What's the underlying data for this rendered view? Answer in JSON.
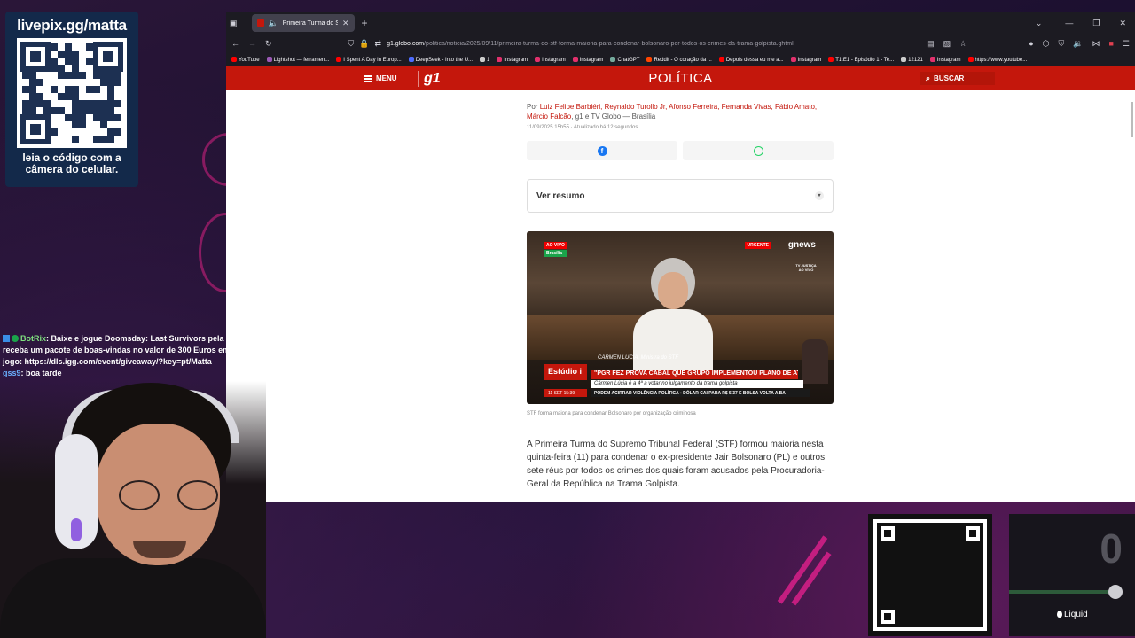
{
  "livepix": {
    "title": "livepix.gg/matta",
    "subtitle_line1": "leia o código com a",
    "subtitle_line2": "câmera do celular."
  },
  "chat": {
    "messages": [
      {
        "user": "BotRix",
        "text": ": Baixe e jogue Doomsday: Last Survivors pela primeira vez e receba um pacote de boas-vindas no valor de 300 Euros em itens no jogo: https://dls.igg.com/event/giveaway/?key=pt/Matta"
      },
      {
        "user": "gss9",
        "text": ": boa tarde"
      }
    ]
  },
  "browser": {
    "tab_title": "Primeira Turma do STF form",
    "url_domain": "g1.globo.com",
    "url_path": "/politica/noticia/2025/09/11/primeira-turma-do-stf-forma-maioria-para-condenar-bolsonaro-por-todos-os-crimes-da-trama-golpista.ghtml",
    "bookmarks": [
      {
        "label": "YouTube",
        "color": "#ff0000"
      },
      {
        "label": "Lightshot — ferramen...",
        "color": "#9b59b6"
      },
      {
        "label": "I Spent A Day in Europ...",
        "color": "#ff0000"
      },
      {
        "label": "DeepSeek - Into the U...",
        "color": "#4d6bfe"
      },
      {
        "label": "1",
        "color": "#cccccc"
      },
      {
        "label": "Instagram",
        "color": "#e1306c"
      },
      {
        "label": "Instagram",
        "color": "#e1306c"
      },
      {
        "label": "Instagram",
        "color": "#e1306c"
      },
      {
        "label": "ChatGPT",
        "color": "#74aa9c"
      },
      {
        "label": "Reddit - O coração da ...",
        "color": "#ff4500"
      },
      {
        "label": "Depois dessa eu me a...",
        "color": "#ff0000"
      },
      {
        "label": "Instagram",
        "color": "#e1306c"
      },
      {
        "label": "T1:E1 - Episódio 1 - Te...",
        "color": "#ff0000"
      },
      {
        "label": "12121",
        "color": "#cccccc"
      },
      {
        "label": "Instagram",
        "color": "#e1306c"
      },
      {
        "label": "https://www.youtube...",
        "color": "#ff0000"
      }
    ]
  },
  "g1": {
    "menu_label": "MENU",
    "logo": "g1",
    "section": "POLÍTICA",
    "search_label": "BUSCAR",
    "brand_color": "#c4170c"
  },
  "article": {
    "byline_prefix": "Por",
    "authors": "Luiz Felipe Barbiéri, Reynaldo Turollo Jr, Afonso Ferreira, Fernanda Vivas, Fábio Amato, Márcio Falcão",
    "byline_suffix": ", g1 e TV Globo — Brasília",
    "date": "11/09/2025 15h55 · Atualizado há 12 segundos",
    "resumo_label": "Ver resumo",
    "caption": "STF forma maioria para condenar Bolsonaro por organização criminosa",
    "body": "A Primeira Turma do Supremo Tribunal Federal (STF) formou maioria nesta quinta-feira (11) para condenar o ex-presidente Jair Bolsonaro (PL) e outros sete réus por todos os crimes dos quais foram acusados pela Procuradoria-Geral da República na Trama Golpista."
  },
  "video": {
    "live_label": "AO VIVO",
    "location": "Brasília",
    "urgent": "URGENTE",
    "channel": "gnews",
    "tv_justica": "TV JUSTIÇA AO VIVO",
    "name_tag": "CÁRMEN LÚCIA, Ministra do STF",
    "studio": "Estúdio i",
    "headline": "\"PGR FEZ PROVA CABAL QUE GRUPO IMPLEMENTOU PLANO DE ATAQUE\"",
    "subline": "Cármen Lúcia é a 4ª a votar no julgamento da trama golpista",
    "time": "11 SET 15:39",
    "ticker": "PODEM ACIRRAR VIOLÊNCIA POLÍTICA  ▪  DÓLAR CAI PARA R$ 5,37 E BOLSA VOLTA A BA"
  },
  "widget": {
    "count": "0",
    "brand": "Liquid",
    "level": 1.0
  }
}
